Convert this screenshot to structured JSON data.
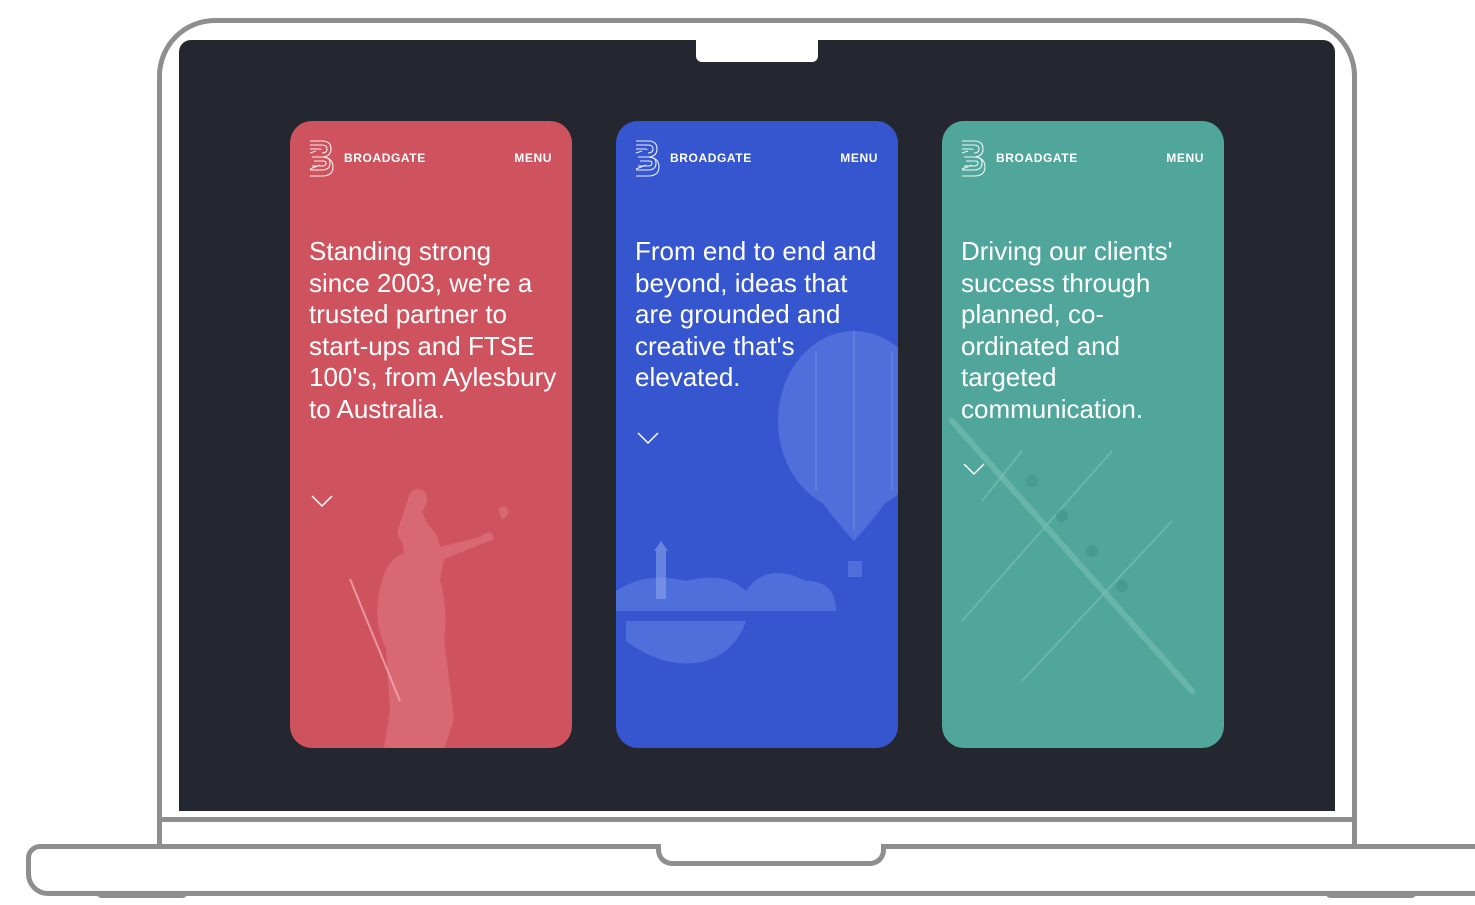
{
  "cards": [
    {
      "theme": "red",
      "color": "#cf535e",
      "brand": "BROADGATE",
      "menu": "MENU",
      "headline": "Standing strong since 2003, we're a trusted partner to start-ups and FTSE 100's, from Aylesbury to Australia.",
      "illustration": "statue-figure"
    },
    {
      "theme": "blue",
      "color": "#3556cf",
      "brand": "BROADGATE",
      "menu": "MENU",
      "headline": "From end to end and beyond, ideas that are grounded and creative that's elevated.",
      "illustration": "hot-air-balloon-lighthouse"
    },
    {
      "theme": "teal",
      "color": "#51a69b",
      "brand": "BROADGATE",
      "menu": "MENU",
      "headline": "Driving our clients' success through planned, co-ordinated and targeted communication.",
      "illustration": "rowing-boats"
    }
  ],
  "icons": {
    "logo": "broadgate-logo-icon",
    "scroll": "chevron-down-icon"
  },
  "frame": {
    "device": "laptop",
    "screen_color": "#252730",
    "bezel_color": "#8e8e8e"
  }
}
